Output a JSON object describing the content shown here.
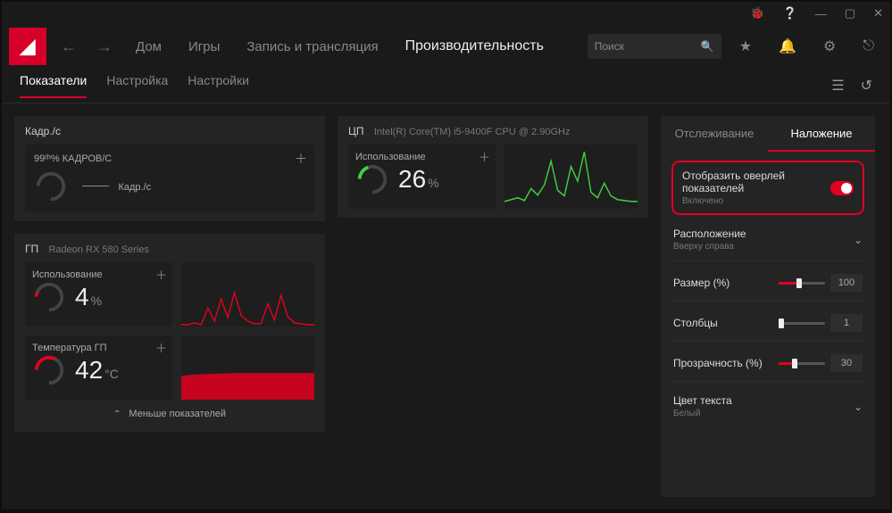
{
  "titlebar": {
    "bug": "🐞",
    "help": "❓",
    "min": "—",
    "max": "▢",
    "close": "✕"
  },
  "nav": {
    "home": "Дом",
    "games": "Игры",
    "record": "Запись и трансляция",
    "perf": "Производительность",
    "search_placeholder": "Поиск"
  },
  "subnav": {
    "metrics": "Показатели",
    "tuning": "Настройка",
    "settings": "Настройки"
  },
  "fps": {
    "title": "Кадр./с",
    "pct_label": "99ᵗʰ% КАДРОВ/С",
    "unit_label": "Кадр./с"
  },
  "gpu": {
    "title": "ГП",
    "name": "Radeon RX 580 Series",
    "usage_label": "Использование",
    "usage_value": "4",
    "usage_unit": "%",
    "temp_label": "Температура ГП",
    "temp_value": "42",
    "temp_unit": "°C",
    "collapse": "Меньше показателей"
  },
  "cpu": {
    "title": "ЦП",
    "name": "Intel(R) Core(TM) i5-9400F CPU @ 2.90GHz",
    "usage_label": "Использование",
    "usage_value": "26",
    "usage_unit": "%"
  },
  "right": {
    "tab_tracking": "Отслеживание",
    "tab_overlay": "Наложение",
    "overlay_toggle_label": "Отобразить оверлей показателей",
    "overlay_toggle_status": "Включено",
    "position_label": "Расположение",
    "position_value": "Вверху справа",
    "size_label": "Размер (%)",
    "size_value": "100",
    "columns_label": "Столбцы",
    "columns_value": "1",
    "transparency_label": "Прозрачность (%)",
    "transparency_value": "30",
    "textcolor_label": "Цвет текста",
    "textcolor_value": "Белый"
  },
  "chart_data": [
    {
      "type": "line",
      "name": "gpu-usage-sparkline",
      "values": [
        1,
        1,
        2,
        1,
        18,
        4,
        30,
        8,
        38,
        12,
        6,
        2,
        2,
        24,
        6,
        34,
        10,
        3,
        2,
        1
      ],
      "ylim": [
        0,
        100
      ],
      "color": "#e40020"
    },
    {
      "type": "area",
      "name": "gpu-temp-sparkline",
      "values": [
        40,
        41,
        41,
        42,
        42,
        42,
        41,
        42,
        42,
        42,
        42,
        42,
        42,
        42,
        42,
        42,
        42,
        42,
        42,
        42
      ],
      "ylim": [
        0,
        100
      ],
      "color": "#e40020"
    },
    {
      "type": "line",
      "name": "cpu-usage-sparkline",
      "values": [
        8,
        10,
        12,
        9,
        22,
        15,
        26,
        55,
        20,
        14,
        48,
        32,
        68,
        18,
        12,
        28,
        14,
        10,
        9,
        8
      ],
      "ylim": [
        0,
        100
      ],
      "color": "#3fd13f"
    }
  ]
}
